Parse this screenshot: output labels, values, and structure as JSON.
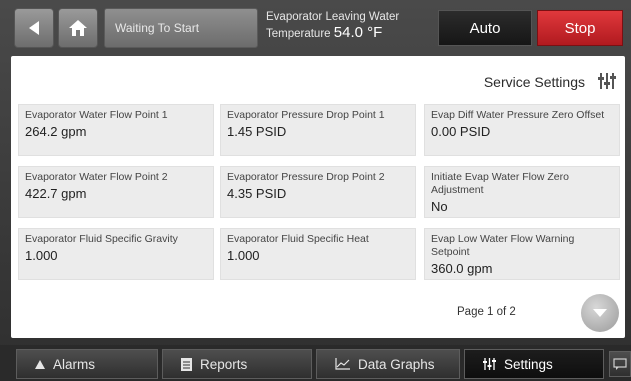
{
  "header": {
    "status_text": "Waiting To Start",
    "temperature_label": "Evaporator Leaving Water",
    "temperature_prefix": "Temperature",
    "temperature_value": "54.0 °F",
    "auto_label": "Auto",
    "stop_label": "Stop",
    "stop_color": "#c8242a"
  },
  "panel": {
    "title": "Service Settings",
    "settings": [
      {
        "label": "Evaporator Water Flow Point 1",
        "value": "264.2 gpm"
      },
      {
        "label": "Evaporator Pressure Drop Point 1",
        "value": "1.45 PSID"
      },
      {
        "label": "Evap Diff Water Pressure Zero Offset",
        "value": "0.00 PSID"
      },
      {
        "label": "Evaporator Water Flow Point 2",
        "value": "422.7 gpm"
      },
      {
        "label": "Evaporator Pressure Drop Point 2",
        "value": "4.35 PSID"
      },
      {
        "label": "Initiate Evap Water Flow Zero Adjustment",
        "value": "No"
      },
      {
        "label": "Evaporator Fluid Specific Gravity",
        "value": "1.000"
      },
      {
        "label": "Evaporator Fluid Specific Heat",
        "value": "1.000"
      },
      {
        "label": "Evap Low Water Flow Warning Setpoint",
        "value": "360.0 gpm"
      }
    ],
    "page_indicator": "Page 1 of 2"
  },
  "nav": {
    "tabs": [
      {
        "label": "Alarms",
        "icon": "triangle-up-icon"
      },
      {
        "label": "Reports",
        "icon": "document-icon"
      },
      {
        "label": "Data Graphs",
        "icon": "graph-icon"
      },
      {
        "label": "Settings",
        "icon": "sliders-icon"
      }
    ],
    "active_tab": "Settings"
  }
}
